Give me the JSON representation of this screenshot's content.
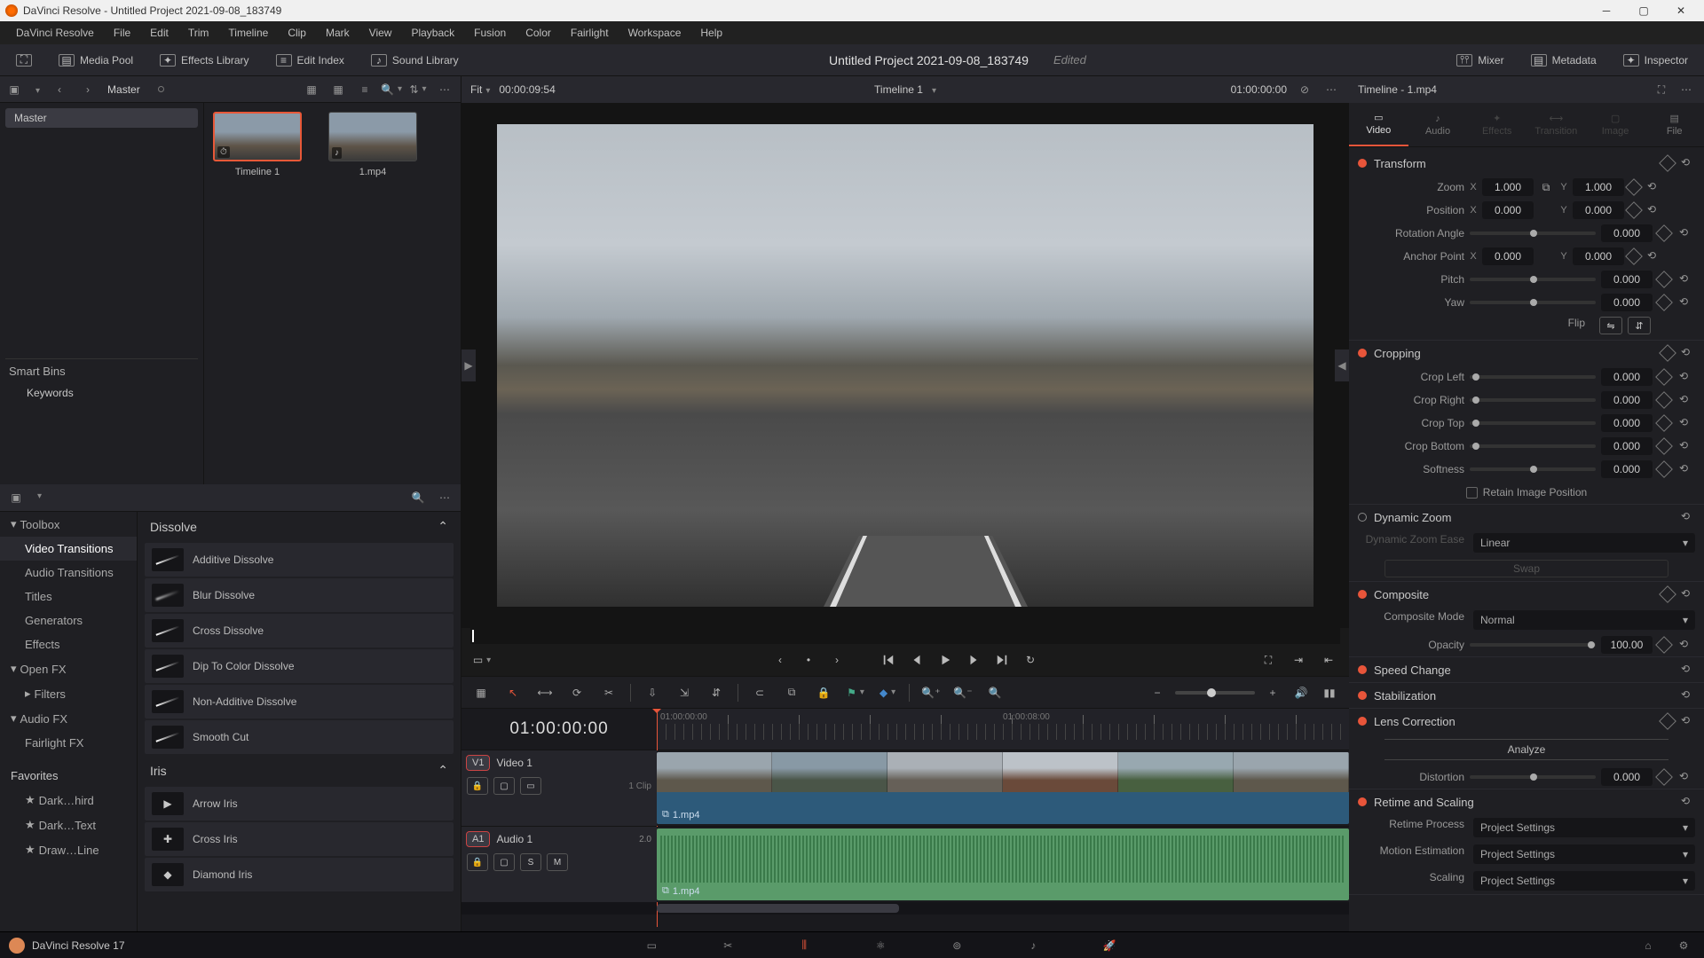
{
  "titlebar": {
    "title": "DaVinci Resolve - Untitled Project 2021-09-08_183749"
  },
  "menu": [
    "DaVinci Resolve",
    "File",
    "Edit",
    "Trim",
    "Timeline",
    "Clip",
    "Mark",
    "View",
    "Playback",
    "Fusion",
    "Color",
    "Fairlight",
    "Workspace",
    "Help"
  ],
  "workspaces": {
    "media_pool": "Media Pool",
    "effects_lib": "Effects Library",
    "edit_index": "Edit Index",
    "sound_library": "Sound Library",
    "mixer": "Mixer",
    "metadata": "Metadata",
    "inspector": "Inspector"
  },
  "project": {
    "title": "Untitled Project 2021-09-08_183749",
    "status": "Edited"
  },
  "pool": {
    "master": "Master",
    "tree_master": "Master",
    "smart_bins": "Smart Bins",
    "keywords": "Keywords",
    "fit": "Fit",
    "source_tc": "00:00:09:54",
    "thumbs": [
      {
        "label": "Timeline 1",
        "badge": "⏱"
      },
      {
        "label": "1.mp4",
        "badge": "♪"
      }
    ]
  },
  "fx": {
    "toolbox": "Toolbox",
    "categories": [
      "Video Transitions",
      "Audio Transitions",
      "Titles",
      "Generators",
      "Effects"
    ],
    "openfx": "Open FX",
    "filters": "Filters",
    "audiofx": "Audio FX",
    "fairlightfx": "Fairlight FX",
    "favorites": "Favorites",
    "fav_items": [
      "Dark…hird",
      "Dark…Text",
      "Draw…Line"
    ],
    "group_dissolve": "Dissolve",
    "group_iris": "Iris",
    "dissolve_items": [
      "Additive Dissolve",
      "Blur Dissolve",
      "Cross Dissolve",
      "Dip To Color Dissolve",
      "Non-Additive Dissolve",
      "Smooth Cut"
    ],
    "iris_items": [
      "Arrow Iris",
      "Cross Iris",
      "Diamond Iris"
    ]
  },
  "viewer": {
    "timeline_name": "Timeline 1",
    "rec_tc": "01:00:00:00"
  },
  "timeline": {
    "tc": "01:00:00:00",
    "ruler_labels": [
      "01:00:00:00",
      "01:00:08:00"
    ],
    "video_track": {
      "tag": "V1",
      "name": "Video 1",
      "clips_info": "1 Clip"
    },
    "audio_track": {
      "tag": "A1",
      "name": "Audio 1",
      "ch": "2.0"
    },
    "clip_name": "1.mp4",
    "audio_clip_name": "1.mp4"
  },
  "inspector": {
    "header": "Timeline - 1.mp4",
    "tabs": [
      "Video",
      "Audio",
      "Effects",
      "Transition",
      "Image",
      "File"
    ],
    "transform": {
      "title": "Transform",
      "zoom": "Zoom",
      "zoom_x": "1.000",
      "zoom_y": "1.000",
      "position": "Position",
      "pos_x": "0.000",
      "pos_y": "0.000",
      "rotation": "Rotation Angle",
      "rotation_v": "0.000",
      "anchor": "Anchor Point",
      "anchor_x": "0.000",
      "anchor_y": "0.000",
      "pitch": "Pitch",
      "pitch_v": "0.000",
      "yaw": "Yaw",
      "yaw_v": "0.000",
      "flip": "Flip"
    },
    "cropping": {
      "title": "Cropping",
      "left": "Crop Left",
      "left_v": "0.000",
      "right": "Crop Right",
      "right_v": "0.000",
      "top": "Crop Top",
      "top_v": "0.000",
      "bottom": "Crop Bottom",
      "bottom_v": "0.000",
      "softness": "Softness",
      "softness_v": "0.000",
      "retain": "Retain Image Position"
    },
    "dynamic_zoom": {
      "title": "Dynamic Zoom",
      "ease_lbl": "Dynamic Zoom Ease",
      "ease_v": "Linear",
      "swap": "Swap"
    },
    "composite": {
      "title": "Composite",
      "mode_lbl": "Composite Mode",
      "mode_v": "Normal",
      "opacity_lbl": "Opacity",
      "opacity_v": "100.00"
    },
    "speed": {
      "title": "Speed Change"
    },
    "stab": {
      "title": "Stabilization"
    },
    "lens": {
      "title": "Lens Correction",
      "analyze": "Analyze",
      "distortion_lbl": "Distortion",
      "distortion_v": "0.000"
    },
    "retime": {
      "title": "Retime and Scaling",
      "process_lbl": "Retime Process",
      "process_v": "Project Settings",
      "motion_lbl": "Motion Estimation",
      "motion_v": "Project Settings",
      "scaling_lbl": "Scaling",
      "scaling_v": "Project Settings"
    }
  },
  "bottom": {
    "app_version": "DaVinci Resolve 17"
  }
}
